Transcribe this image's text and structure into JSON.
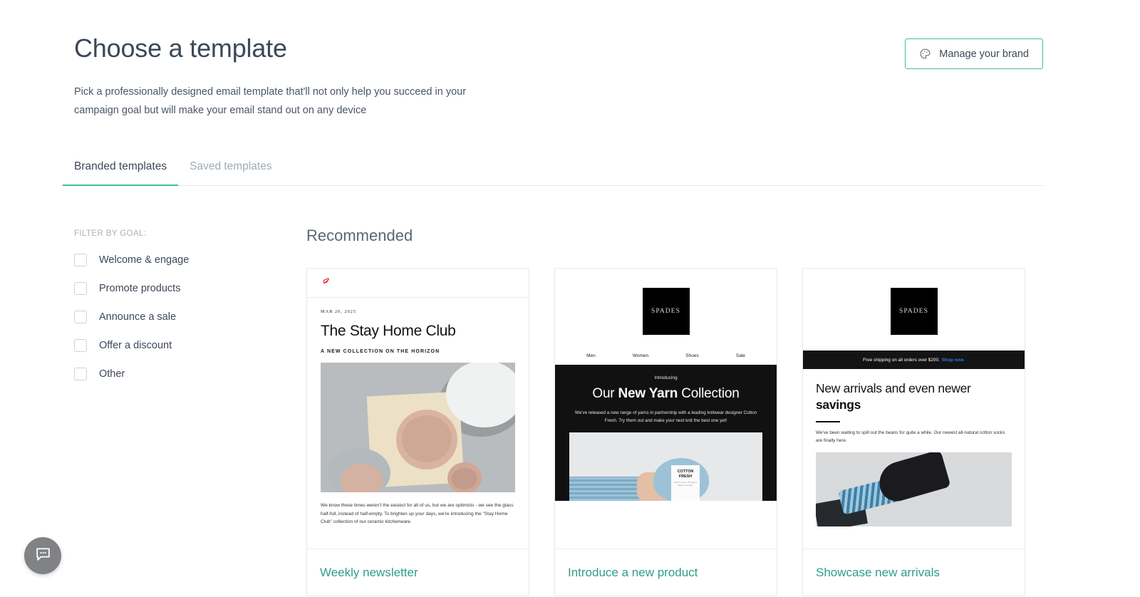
{
  "header": {
    "title": "Choose a template",
    "subtitle": "Pick a professionally designed email template that'll not only help you succeed in your campaign goal but will make your email stand out on any device",
    "brand_button": "Manage your brand",
    "brand_button_icon": "palette-icon"
  },
  "tabs": [
    {
      "label": "Branded templates",
      "active": true
    },
    {
      "label": "Saved templates",
      "active": false
    }
  ],
  "sidebar": {
    "filter_label": "FILTER BY GOAL:",
    "items": [
      {
        "label": "Welcome & engage",
        "checked": false
      },
      {
        "label": "Promote products",
        "checked": false
      },
      {
        "label": "Announce a sale",
        "checked": false
      },
      {
        "label": "Offer a discount",
        "checked": false
      },
      {
        "label": "Other",
        "checked": false
      }
    ]
  },
  "main": {
    "section_title": "Recommended",
    "cards": [
      {
        "title": "Weekly newsletter",
        "preview": {
          "logo_icon": "red-leaf-logo",
          "date": "MAR 26, 2025",
          "heading": "The Stay Home Club",
          "kicker": "A NEW COLLECTION ON THE HORIZON",
          "body": "We know these times weren't the easiest for all of us, but we are optimists - we see the glass half-full, instead of half-empty. To brighten up your days, we're introducing the \"Stay Home Club\" collection of our ceramic kitchenware."
        }
      },
      {
        "title": "Introduce a new product",
        "preview": {
          "logo": "SPADES",
          "nav": [
            "Men",
            "Women",
            "Shoes",
            "Sale"
          ],
          "eyebrow": "Introducing",
          "heading_part1": "Our ",
          "heading_bold": "New Yarn",
          "heading_part2": " Collection",
          "body": "We've released a new range of yarns in partnership with a leading knitwear designer Cotton Fresh. Try them out and make your next knit the best one yet!",
          "product_label_line1": "COTTON",
          "product_label_line2": "FRESH",
          "product_label_sub": "100 % cotton | 50 grams Made in Europe"
        }
      },
      {
        "title": "Showcase new arrivals",
        "preview": {
          "logo": "SPADES",
          "banner_text": "Free shipping on all orders over $200.",
          "banner_link": "Shop now.",
          "heading_part1": "New arrivals and even newer ",
          "heading_bold": "savings",
          "body": "We've been waiting to spill out the beans for quite a while. Our newest all-natural cotton socks are finally here."
        }
      }
    ]
  },
  "chat": {
    "icon": "chat-bubble-icon"
  },
  "colors": {
    "accent_teal": "#3fbf9a",
    "title_teal": "#2f9e87",
    "text_dark": "#3c4858",
    "link_blue": "#2a7fe0"
  }
}
